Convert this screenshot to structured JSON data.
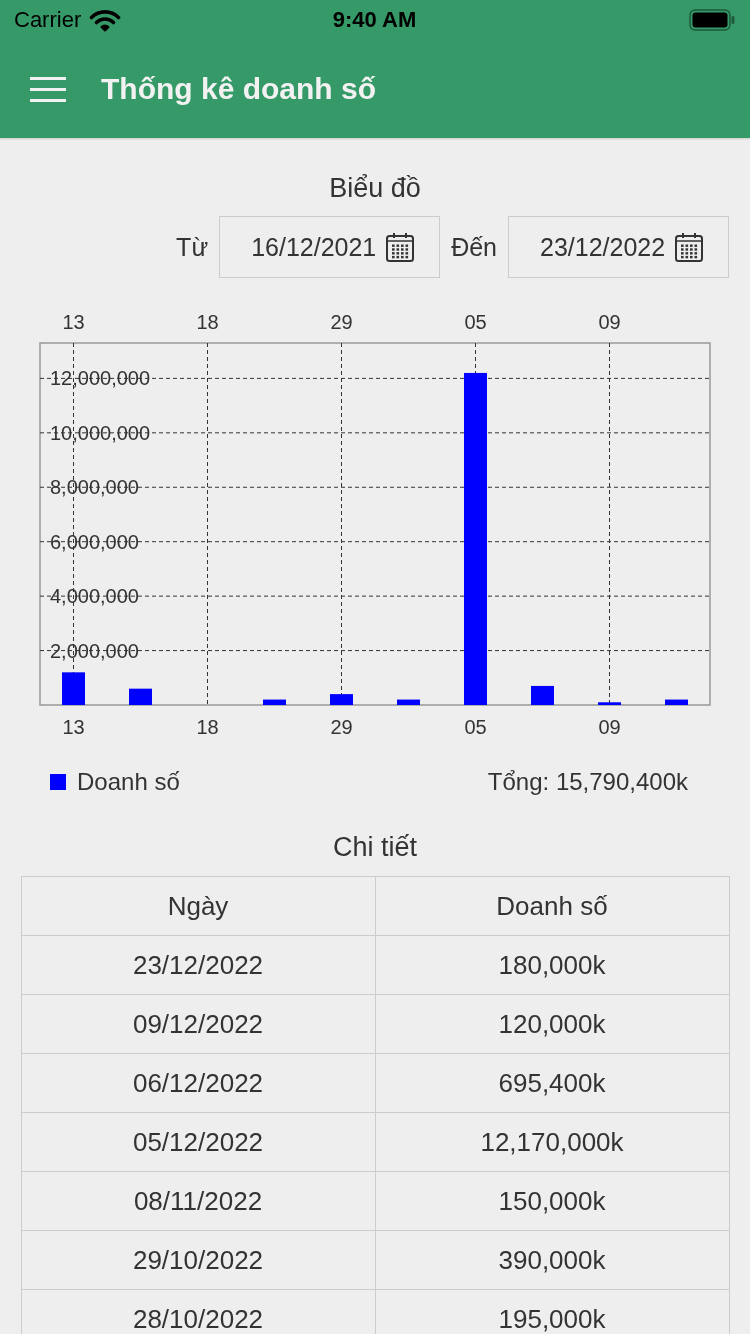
{
  "status_bar": {
    "carrier": "Carrier",
    "time": "9:40 AM"
  },
  "header": {
    "title": "Thống kê doanh số"
  },
  "chart_section": {
    "title": "Biểu đồ",
    "date_range": [
      {
        "label": "Từ",
        "value": "16/12/2021"
      },
      {
        "label": "Đến",
        "value": "23/12/2022"
      }
    ]
  },
  "chart": {
    "top_labels": [
      "13",
      "18",
      "29",
      "05",
      "09"
    ],
    "chart_data": {
      "type": "bar",
      "grid": true,
      "categories": [
        "13",
        null,
        "18",
        null,
        "29",
        null,
        "05",
        null,
        "09",
        null
      ],
      "ylim": [
        0,
        13300000
      ],
      "yticks": [
        {
          "value": 2000000,
          "label": "2,000,000"
        },
        {
          "value": 4000000,
          "label": "4,000,000"
        },
        {
          "value": 6000000,
          "label": "6,000,000"
        },
        {
          "value": 8000000,
          "label": "8,000,000"
        },
        {
          "value": 10000000,
          "label": "10,000,000"
        },
        {
          "value": 12000000,
          "label": "12,000,000"
        }
      ],
      "series": [
        {
          "name": "Doanh số",
          "color": "#0000ff",
          "values": [
            1200000,
            600000,
            0,
            200000,
            400000,
            200000,
            12200000,
            700000,
            100000,
            200000
          ]
        }
      ]
    }
  },
  "total": "Tổng: 15,790,400k",
  "detail": {
    "title": "Chi tiết",
    "columns": [
      "Ngày",
      "Doanh số"
    ],
    "rows": [
      [
        "23/12/2022",
        "180,000k"
      ],
      [
        "09/12/2022",
        "120,000k"
      ],
      [
        "06/12/2022",
        "695,400k"
      ],
      [
        "05/12/2022",
        "12,170,000k"
      ],
      [
        "08/11/2022",
        "150,000k"
      ],
      [
        "29/10/2022",
        "390,000k"
      ],
      [
        "28/10/2022",
        "195,000k"
      ]
    ]
  }
}
